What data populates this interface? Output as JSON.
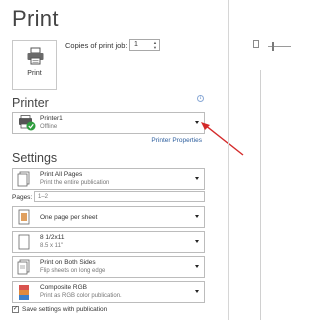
{
  "title": "Print",
  "print_button": {
    "label": "Print",
    "icon": "printer-icon"
  },
  "copies": {
    "label": "Copies of print job:",
    "value": "1"
  },
  "printer": {
    "section_title": "Printer",
    "name": "Printer1",
    "status": "Offline",
    "properties_link": "Printer Properties",
    "status_color": "#2e9e3e"
  },
  "settings": {
    "section_title": "Settings",
    "print_pages": {
      "main": "Print All Pages",
      "sub": "Print the entire publication"
    },
    "pages": {
      "label": "Pages:",
      "placeholder": "1–2"
    },
    "per_sheet": {
      "main": "One page per sheet"
    },
    "paper": {
      "main": "8 1/2x11",
      "sub": "8.5 x 11\""
    },
    "sides": {
      "main": "Print on Both Sides",
      "sub": "Flip sheets on long edge"
    },
    "color": {
      "main": "Composite RGB",
      "sub": "Print as RGB color publication."
    },
    "save_checkbox": {
      "label": "Save settings with publication",
      "checked": true
    }
  },
  "colors": {
    "accent_link": "#2e5f9e",
    "annotation_arrow": "#d42a2a"
  }
}
